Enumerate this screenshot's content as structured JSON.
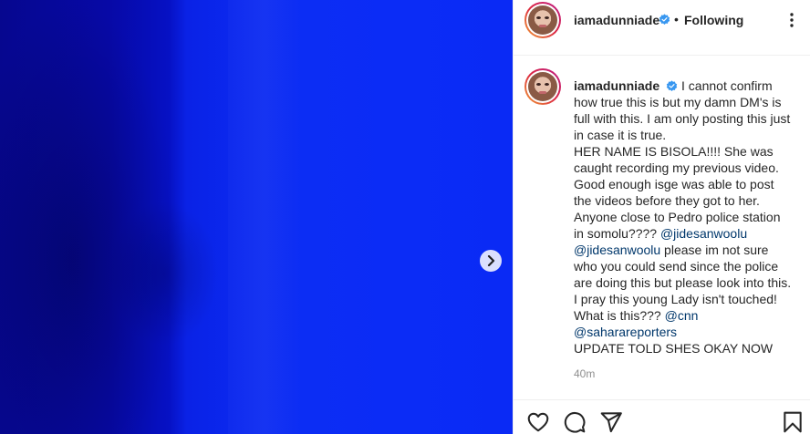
{
  "post": {
    "username": "iamadunniade",
    "follow_separator": "•",
    "follow_status": "Following",
    "caption": {
      "intro": "I cannot confirm how true this is but my damn DM's is full with this. I am only posting this just in case it is true.",
      "line2": "HER NAME IS BISOLA!!!! She was caught recording my previous video. Good enough isge was able to post the videos before they got to her. Anyone close to Pedro police station in somolu???? ",
      "mention1": "@jidesanwoolu",
      "mention2": "@jidesanwoolu",
      "line3": " please im not sure who you could send since the police are doing this but please look into this. I pray this young Lady isn't touched! What is this??? ",
      "mention3": "@cnn",
      "mention4": "@saharareporters",
      "update": "UPDATE TOLD SHES OKAY NOW"
    },
    "time_ago": "40m"
  },
  "icons": {
    "verified": "verified-badge-icon",
    "more": "more-options-icon",
    "next": "chevron-right-icon",
    "like": "heart-icon",
    "comment": "comment-bubble-icon",
    "share": "paper-plane-icon",
    "save": "bookmark-icon"
  },
  "colors": {
    "media_blue": "#0b2cf6",
    "verified_blue": "#3897f0",
    "mention_blue": "#00376b",
    "muted_text": "#8e8e8e"
  }
}
